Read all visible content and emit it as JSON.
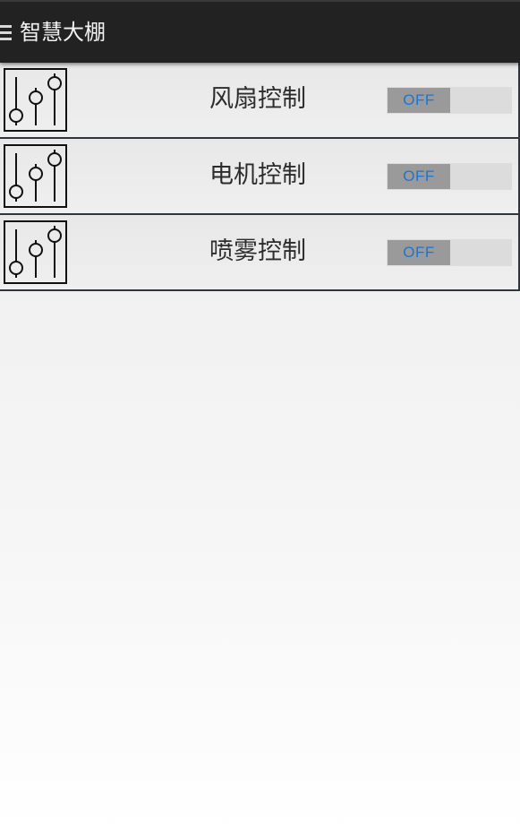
{
  "header": {
    "menu_icon": "hamburger-menu-icon",
    "title": "智慧大棚"
  },
  "controls": [
    {
      "label": "风扇控制",
      "icon": "sliders-icon",
      "state": "OFF"
    },
    {
      "label": "电机控制",
      "icon": "sliders-icon",
      "state": "OFF"
    },
    {
      "label": "喷雾控制",
      "icon": "sliders-icon",
      "state": "OFF"
    }
  ],
  "colors": {
    "topbar": "#222222",
    "toggle_text": "#1976d2",
    "toggle_thumb": "#9a9a9a",
    "toggle_track": "#dcdcdc",
    "divider": "#2f3640"
  }
}
